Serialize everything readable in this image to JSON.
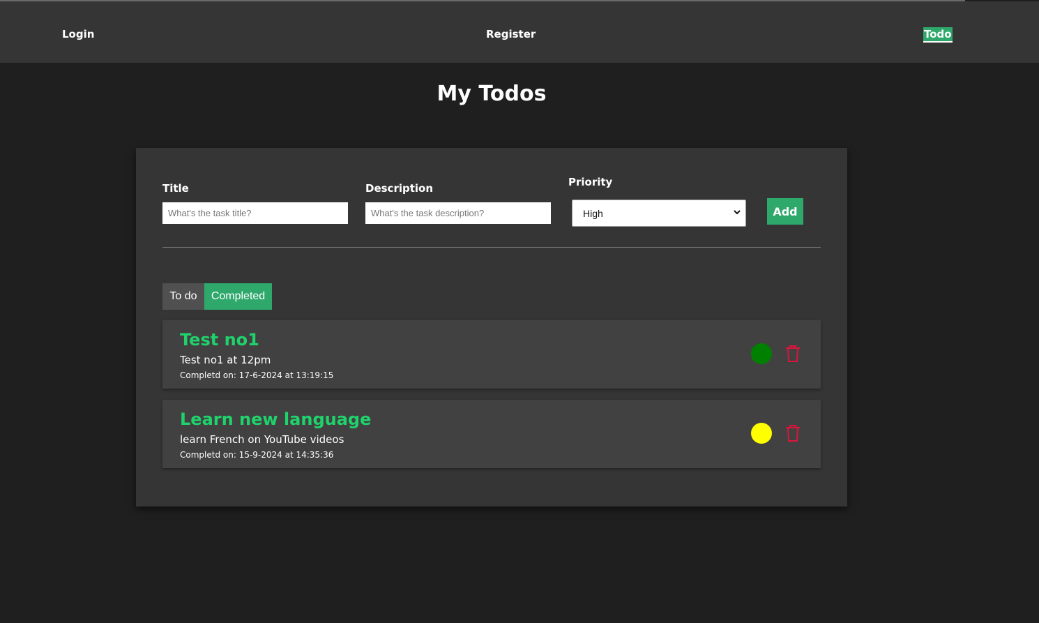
{
  "nav": {
    "login": "Login",
    "register": "Register",
    "todo": "Todo"
  },
  "page": {
    "title": "My Todos"
  },
  "form": {
    "title_label": "Title",
    "title_placeholder": "What's the task title?",
    "description_label": "Description",
    "description_placeholder": "What's the task description?",
    "priority_label": "Priority",
    "priority_value": "High",
    "add_label": "Add"
  },
  "tabs": {
    "todo": "To do",
    "completed": "Completed"
  },
  "todos": [
    {
      "title": "Test no1",
      "description": "Test no1 at 12pm",
      "completed_text": "Completd on: 17-6-2024 at 13:19:15",
      "priority_color": "#008000"
    },
    {
      "title": "Learn new language",
      "description": "learn French on YouTube videos",
      "completed_text": "Completd on: 15-9-2024 at 14:35:36",
      "priority_color": "#ffff00"
    }
  ],
  "colors": {
    "accent": "#2ea86b",
    "title_green": "#1fd26b",
    "delete_red": "#dc143c"
  }
}
